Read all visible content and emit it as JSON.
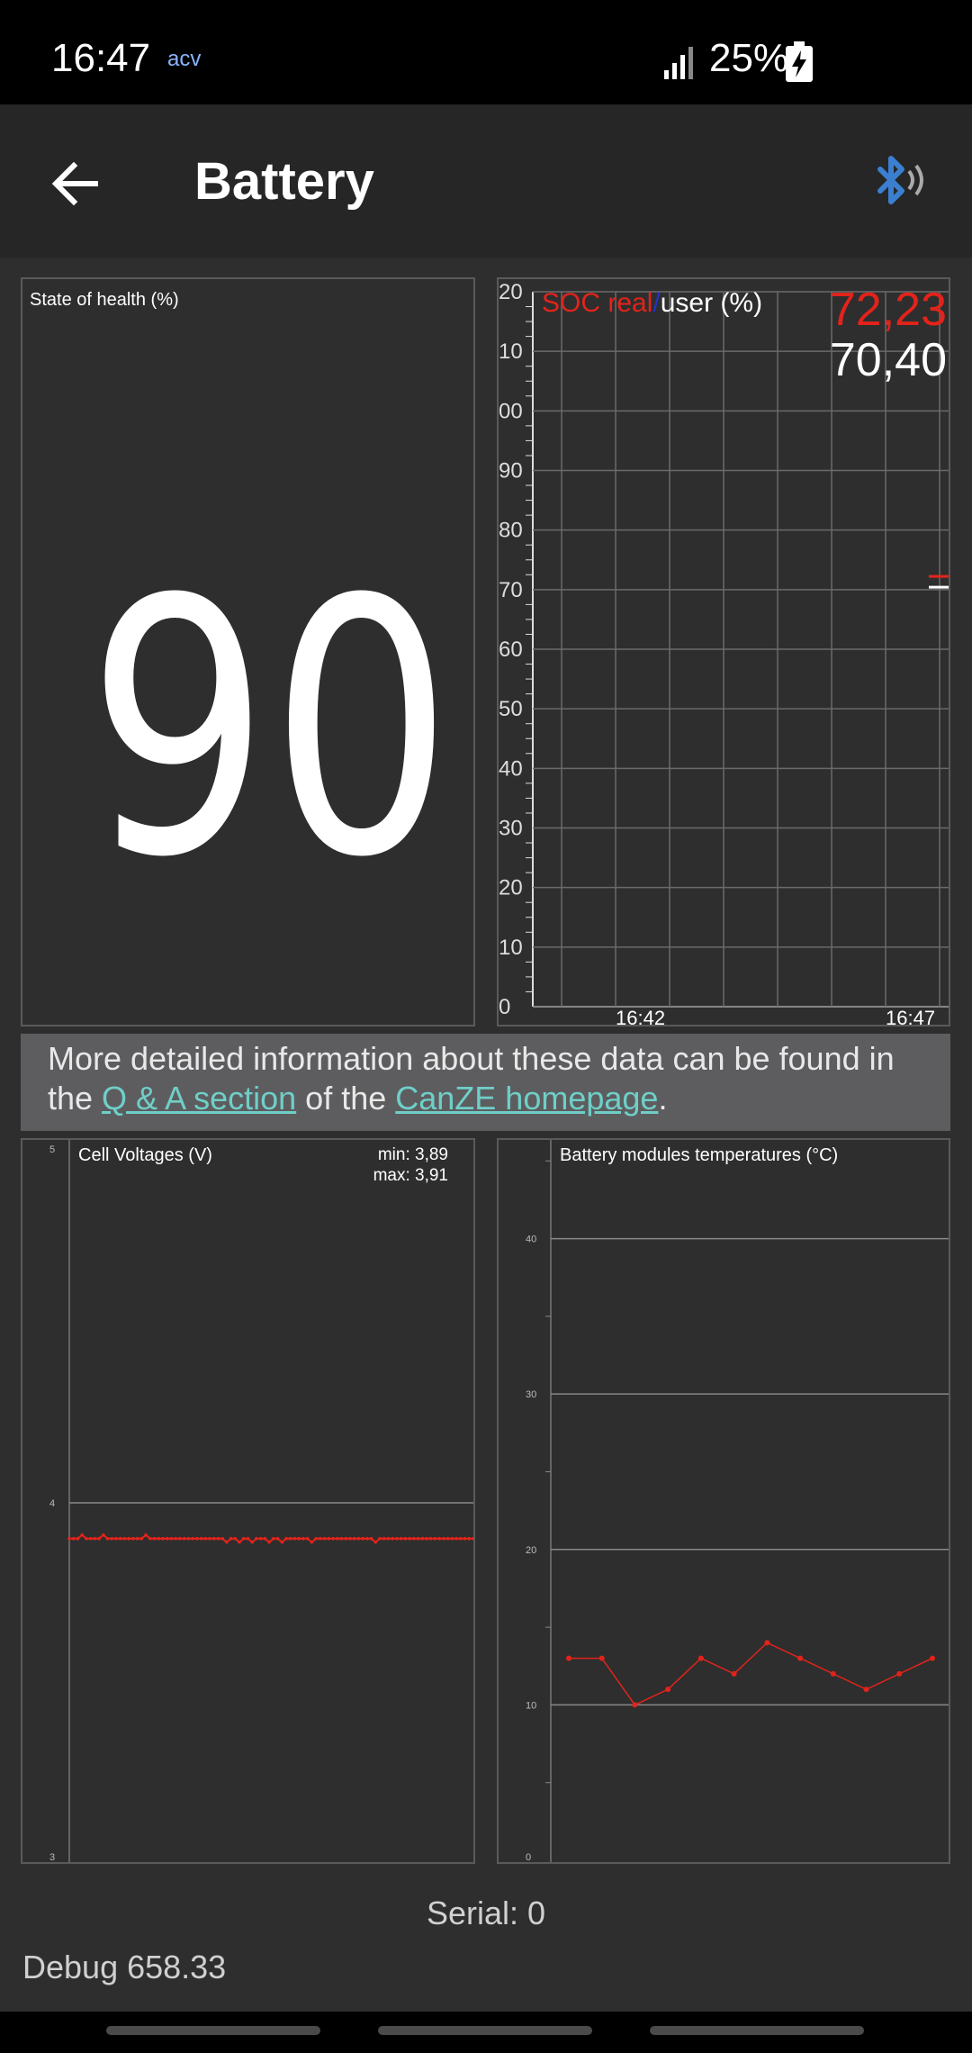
{
  "status_bar": {
    "time": "16:47",
    "indicator": "acv",
    "battery_percent": "25%",
    "icons": [
      "signal-icon",
      "battery-charging-icon"
    ]
  },
  "app_bar": {
    "title": "Battery",
    "back_icon": "arrow-back-icon",
    "bluetooth_icon": "bluetooth-connected-icon",
    "bluetooth_color": "#3b7fd0"
  },
  "soh": {
    "label": "State of health (%)",
    "value": "90"
  },
  "soc": {
    "label_real": "SOC real",
    "label_slash": "/",
    "label_user": "user (%)",
    "real_value": "72,23",
    "user_value": "70,40",
    "real_color": "#e3231b",
    "user_color": "#ffffff"
  },
  "info": {
    "text_before": "More detailed information about these data can be found in the ",
    "link1": "Q & A section",
    "text_middle": " of the ",
    "link2": "CanZE homepage",
    "text_after": "."
  },
  "cell_voltages": {
    "title": "Cell Voltages (V)",
    "min": "min: 3,89",
    "max": "max: 3,91"
  },
  "module_temps": {
    "title": "Battery modules temperatures (°C)"
  },
  "serial": "Serial: 0",
  "debug": "Debug 658.33",
  "chart_data": [
    {
      "type": "line",
      "title": "SOC real/user (%)",
      "x_ticks": [
        "16:42",
        "16:47"
      ],
      "y_ticks": [
        "0",
        "10",
        "20",
        "30",
        "40",
        "50",
        "60",
        "70",
        "80",
        "90",
        "00",
        "10",
        "20"
      ],
      "ylim": [
        0,
        120
      ],
      "grid": true,
      "series": [
        {
          "name": "SOC real",
          "color": "#e3231b",
          "values": [
            72.23
          ]
        },
        {
          "name": "user",
          "color": "#ffffff",
          "values": [
            70.4
          ]
        }
      ]
    },
    {
      "type": "line",
      "title": "Cell Voltages (V)",
      "y_ticks": [
        "3",
        "4",
        "5"
      ],
      "ylim": [
        3,
        5
      ],
      "grid": true,
      "series": [
        {
          "name": "cells",
          "color": "#e3231b",
          "values": [
            3.9,
            3.9,
            3.9,
            3.91,
            3.9,
            3.9,
            3.9,
            3.9,
            3.91,
            3.9,
            3.9,
            3.9,
            3.9,
            3.9,
            3.9,
            3.9,
            3.9,
            3.9,
            3.91,
            3.9,
            3.9,
            3.9,
            3.9,
            3.9,
            3.9,
            3.9,
            3.9,
            3.9,
            3.9,
            3.9,
            3.9,
            3.9,
            3.9,
            3.9,
            3.9,
            3.9,
            3.9,
            3.89,
            3.9,
            3.9,
            3.89,
            3.9,
            3.9,
            3.89,
            3.9,
            3.9,
            3.9,
            3.89,
            3.9,
            3.9,
            3.89,
            3.9,
            3.9,
            3.9,
            3.9,
            3.9,
            3.9,
            3.89,
            3.9,
            3.9,
            3.9,
            3.9,
            3.9,
            3.9,
            3.9,
            3.9,
            3.9,
            3.9,
            3.9,
            3.9,
            3.9,
            3.9,
            3.89,
            3.9,
            3.9,
            3.9,
            3.9,
            3.9,
            3.9,
            3.9,
            3.9,
            3.9,
            3.9,
            3.9,
            3.9,
            3.9,
            3.9,
            3.9,
            3.9,
            3.9,
            3.9,
            3.9,
            3.9,
            3.9,
            3.9,
            3.9
          ]
        }
      ]
    },
    {
      "type": "line",
      "title": "Battery modules temperatures (°C)",
      "y_ticks": [
        "0",
        "10",
        "20",
        "30",
        "40"
      ],
      "ylim": [
        0,
        46
      ],
      "grid": true,
      "series": [
        {
          "name": "modules",
          "color": "#e3231b",
          "values": [
            13,
            13,
            10,
            11,
            13,
            12,
            14,
            13,
            12,
            11,
            12,
            13
          ]
        }
      ]
    }
  ]
}
